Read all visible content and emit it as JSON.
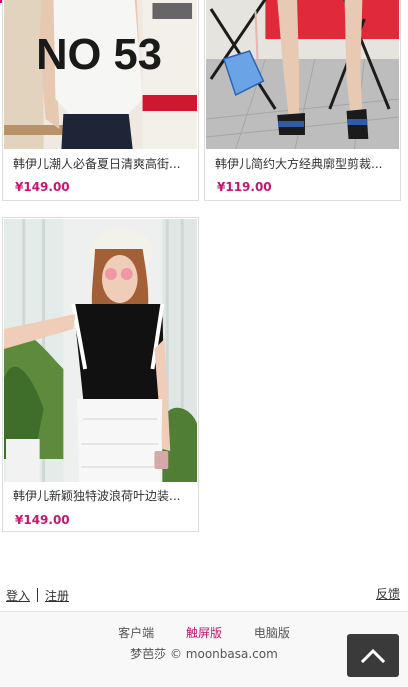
{
  "products": [
    {
      "title": "韩伊儿潮人必备夏日清爽高街...",
      "price": "¥149.00",
      "image_text": "NO 53"
    },
    {
      "title": "韩伊儿简约大方经典廓型剪裁...",
      "price": "¥119.00"
    },
    {
      "title": "韩伊儿新颖独特波浪荷叶边装...",
      "price": "¥149.00"
    }
  ],
  "footer": {
    "login": "登入",
    "register": "注册",
    "feedback": "反馈",
    "versions": [
      {
        "label": "客户端",
        "active": false
      },
      {
        "label": "触屏版",
        "active": true
      },
      {
        "label": "电脑版",
        "active": false
      }
    ],
    "copyright": "梦芭莎 © moonbasa.com"
  },
  "colors": {
    "accent": "#c8156f",
    "back_to_top_bg": "#3a3a3a"
  },
  "icons": {
    "back_to_top": "chevron-up-icon"
  }
}
